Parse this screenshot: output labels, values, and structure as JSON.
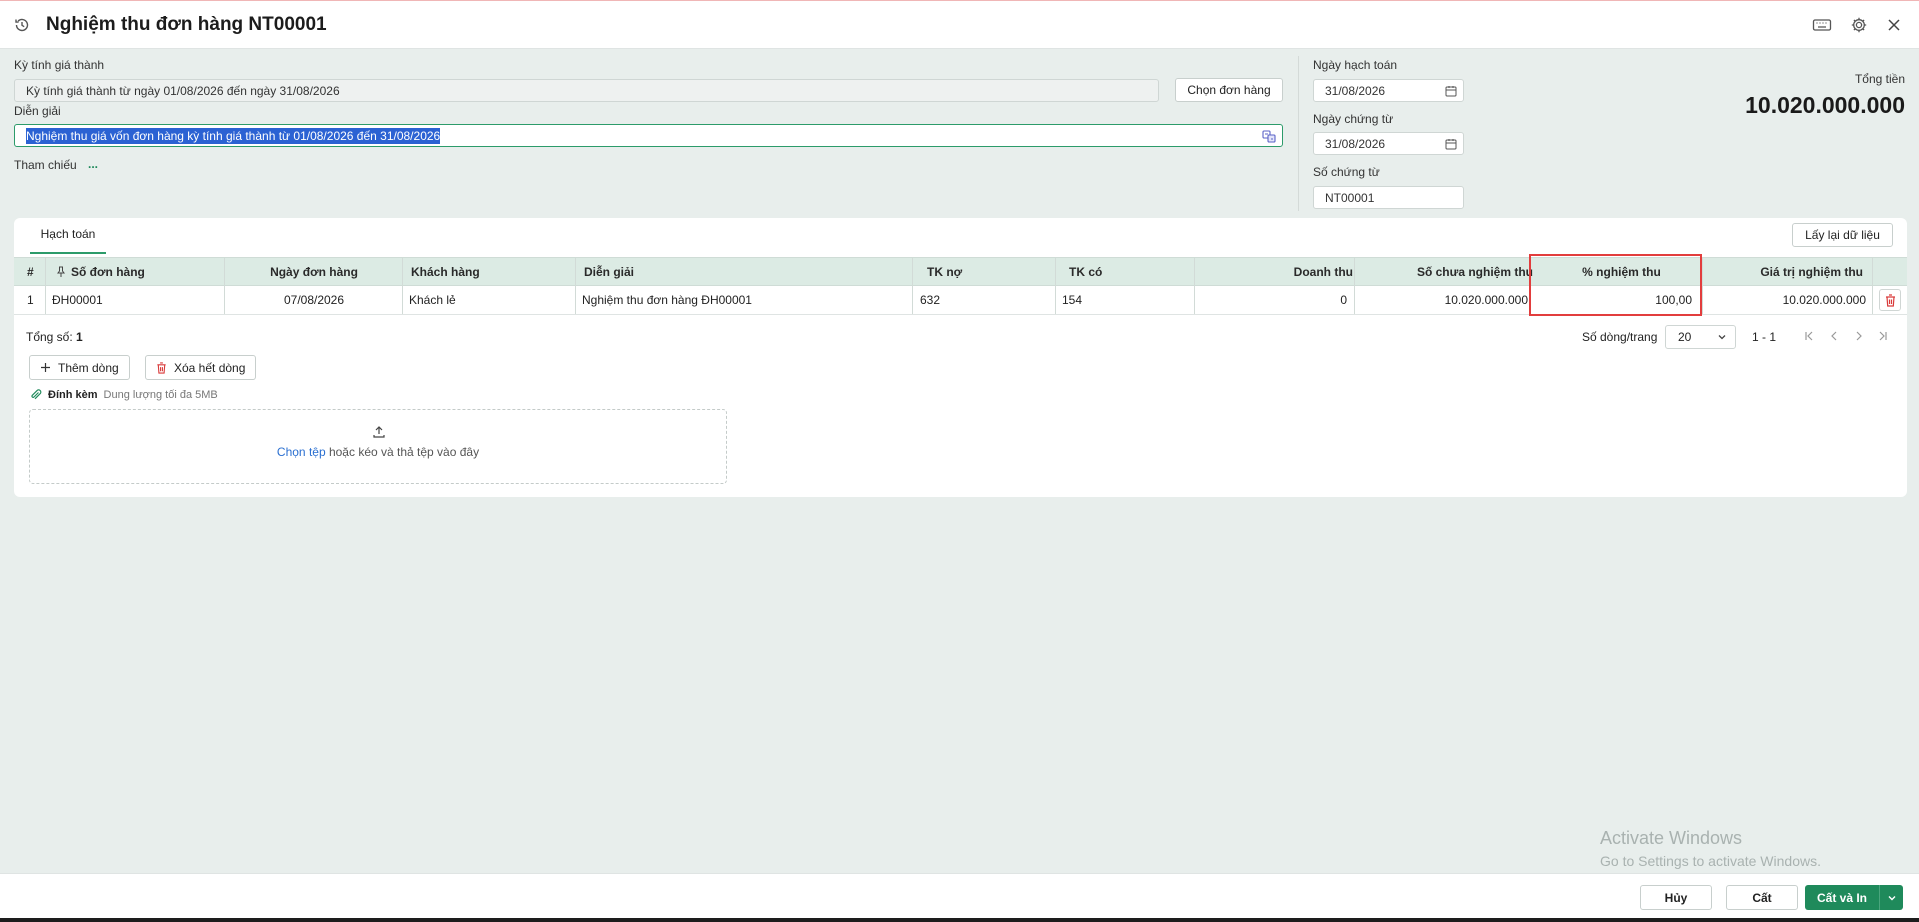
{
  "header": {
    "title": "Nghiệm thu đơn hàng NT00001"
  },
  "form": {
    "period_label": "Kỳ tính giá thành",
    "period_value": "Kỳ tính giá thành từ ngày 01/08/2026 đến ngày 31/08/2026",
    "choose_order_label": "Chọn đơn hàng",
    "desc_label": "Diễn giải",
    "desc_value": "Nghiệm thu giá vốn đơn hàng kỳ tính giá thành từ 01/08/2026 đến 31/08/2026",
    "ref_label": "Tham chiếu",
    "ref_more": "...",
    "posting_date_label": "Ngày hạch toán",
    "posting_date": "31/08/2026",
    "doc_date_label": "Ngày chứng từ",
    "doc_date": "31/08/2026",
    "doc_no_label": "Số chứng từ",
    "doc_no": "NT00001",
    "total_label": "Tổng tiền",
    "total_value": "10.020.000.000"
  },
  "card": {
    "tab_label": "Hạch toán",
    "reload_label": "Lấy lại dữ liệu",
    "columns": {
      "idx": "#",
      "order_no": "Số đơn hàng",
      "order_date": "Ngày đơn hàng",
      "customer": "Khách hàng",
      "desc": "Diễn giải",
      "debit": "TK nợ",
      "credit": "TK có",
      "revenue": "Doanh thu",
      "unaccepted": "Số chưa nghiệm thu",
      "percent": "% nghiệm thu",
      "value": "Giá trị nghiệm thu"
    },
    "rows": [
      {
        "idx": "1",
        "order_no": "ĐH00001",
        "order_date": "07/08/2026",
        "customer": "Khách lẻ",
        "desc": "Nghiệm thu đơn hàng ĐH00001",
        "debit": "632",
        "credit": "154",
        "revenue": "0",
        "unaccepted": "10.020.000.000",
        "percent": "100,00",
        "value": "10.020.000.000"
      }
    ],
    "count_label": "Tổng số:",
    "count_value": "1",
    "page_size_label": "Số dòng/trang",
    "page_size": "20",
    "page_range": "1 - 1",
    "add_row_label": "Thêm dòng",
    "clear_rows_label": "Xóa hết dòng",
    "attach_label": "Đính kèm",
    "attach_size": "Dung lượng tối đa 5MB",
    "drop_link": "Chọn tệp",
    "drop_text": " hoặc kéo và thả tệp vào đây"
  },
  "watermark": {
    "line1": "Activate Windows",
    "line2": "Go to Settings to activate Windows."
  },
  "footer": {
    "cancel_label": "Hủy",
    "save_label": "Cất",
    "save_print_label": "Cất và In"
  },
  "colors": {
    "accent": "#1f8a5b",
    "highlight": "#e23d3d",
    "selection": "#2b62d3"
  }
}
